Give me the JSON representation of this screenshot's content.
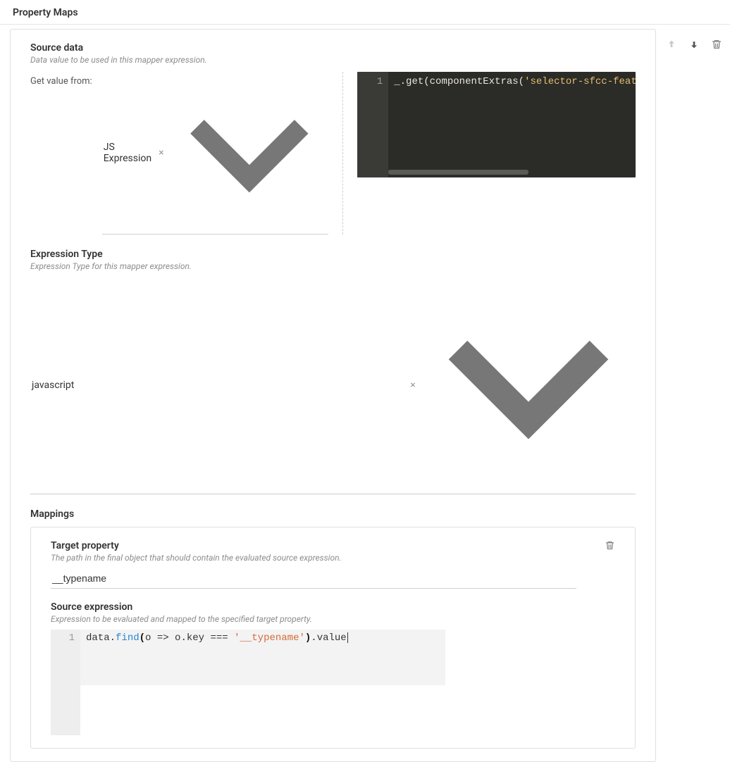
{
  "header": {
    "title": "Property Maps"
  },
  "sourceData": {
    "title": "Source data",
    "help": "Data value to be used in this mapper expression.",
    "getValueLabel": "Get value from:",
    "selectValue": "JS Expression",
    "editor": {
      "lineNo": "1",
      "prefix": "_.get(componentExtras(",
      "str": "'selector-sfcc-featured-products'"
    }
  },
  "expressionType": {
    "title": "Expression Type",
    "help": "Expression Type for this mapper expression.",
    "value": "javascript"
  },
  "mappings": {
    "title": "Mappings",
    "item": {
      "targetTitle": "Target property",
      "targetHelp": "The path in the final object that should contain the evaluated source expression.",
      "targetValue": "__typename",
      "sourceTitle": "Source expression",
      "sourceHelp": "Expression to be evaluated and mapped to the specified target property.",
      "codeLineNo": "1",
      "code": {
        "p1": "data.",
        "p2": "find",
        "p3": "(",
        "p4": "o => o.key === ",
        "p5": "'__typename'",
        "p6": ")",
        "p7": ".value"
      }
    }
  }
}
